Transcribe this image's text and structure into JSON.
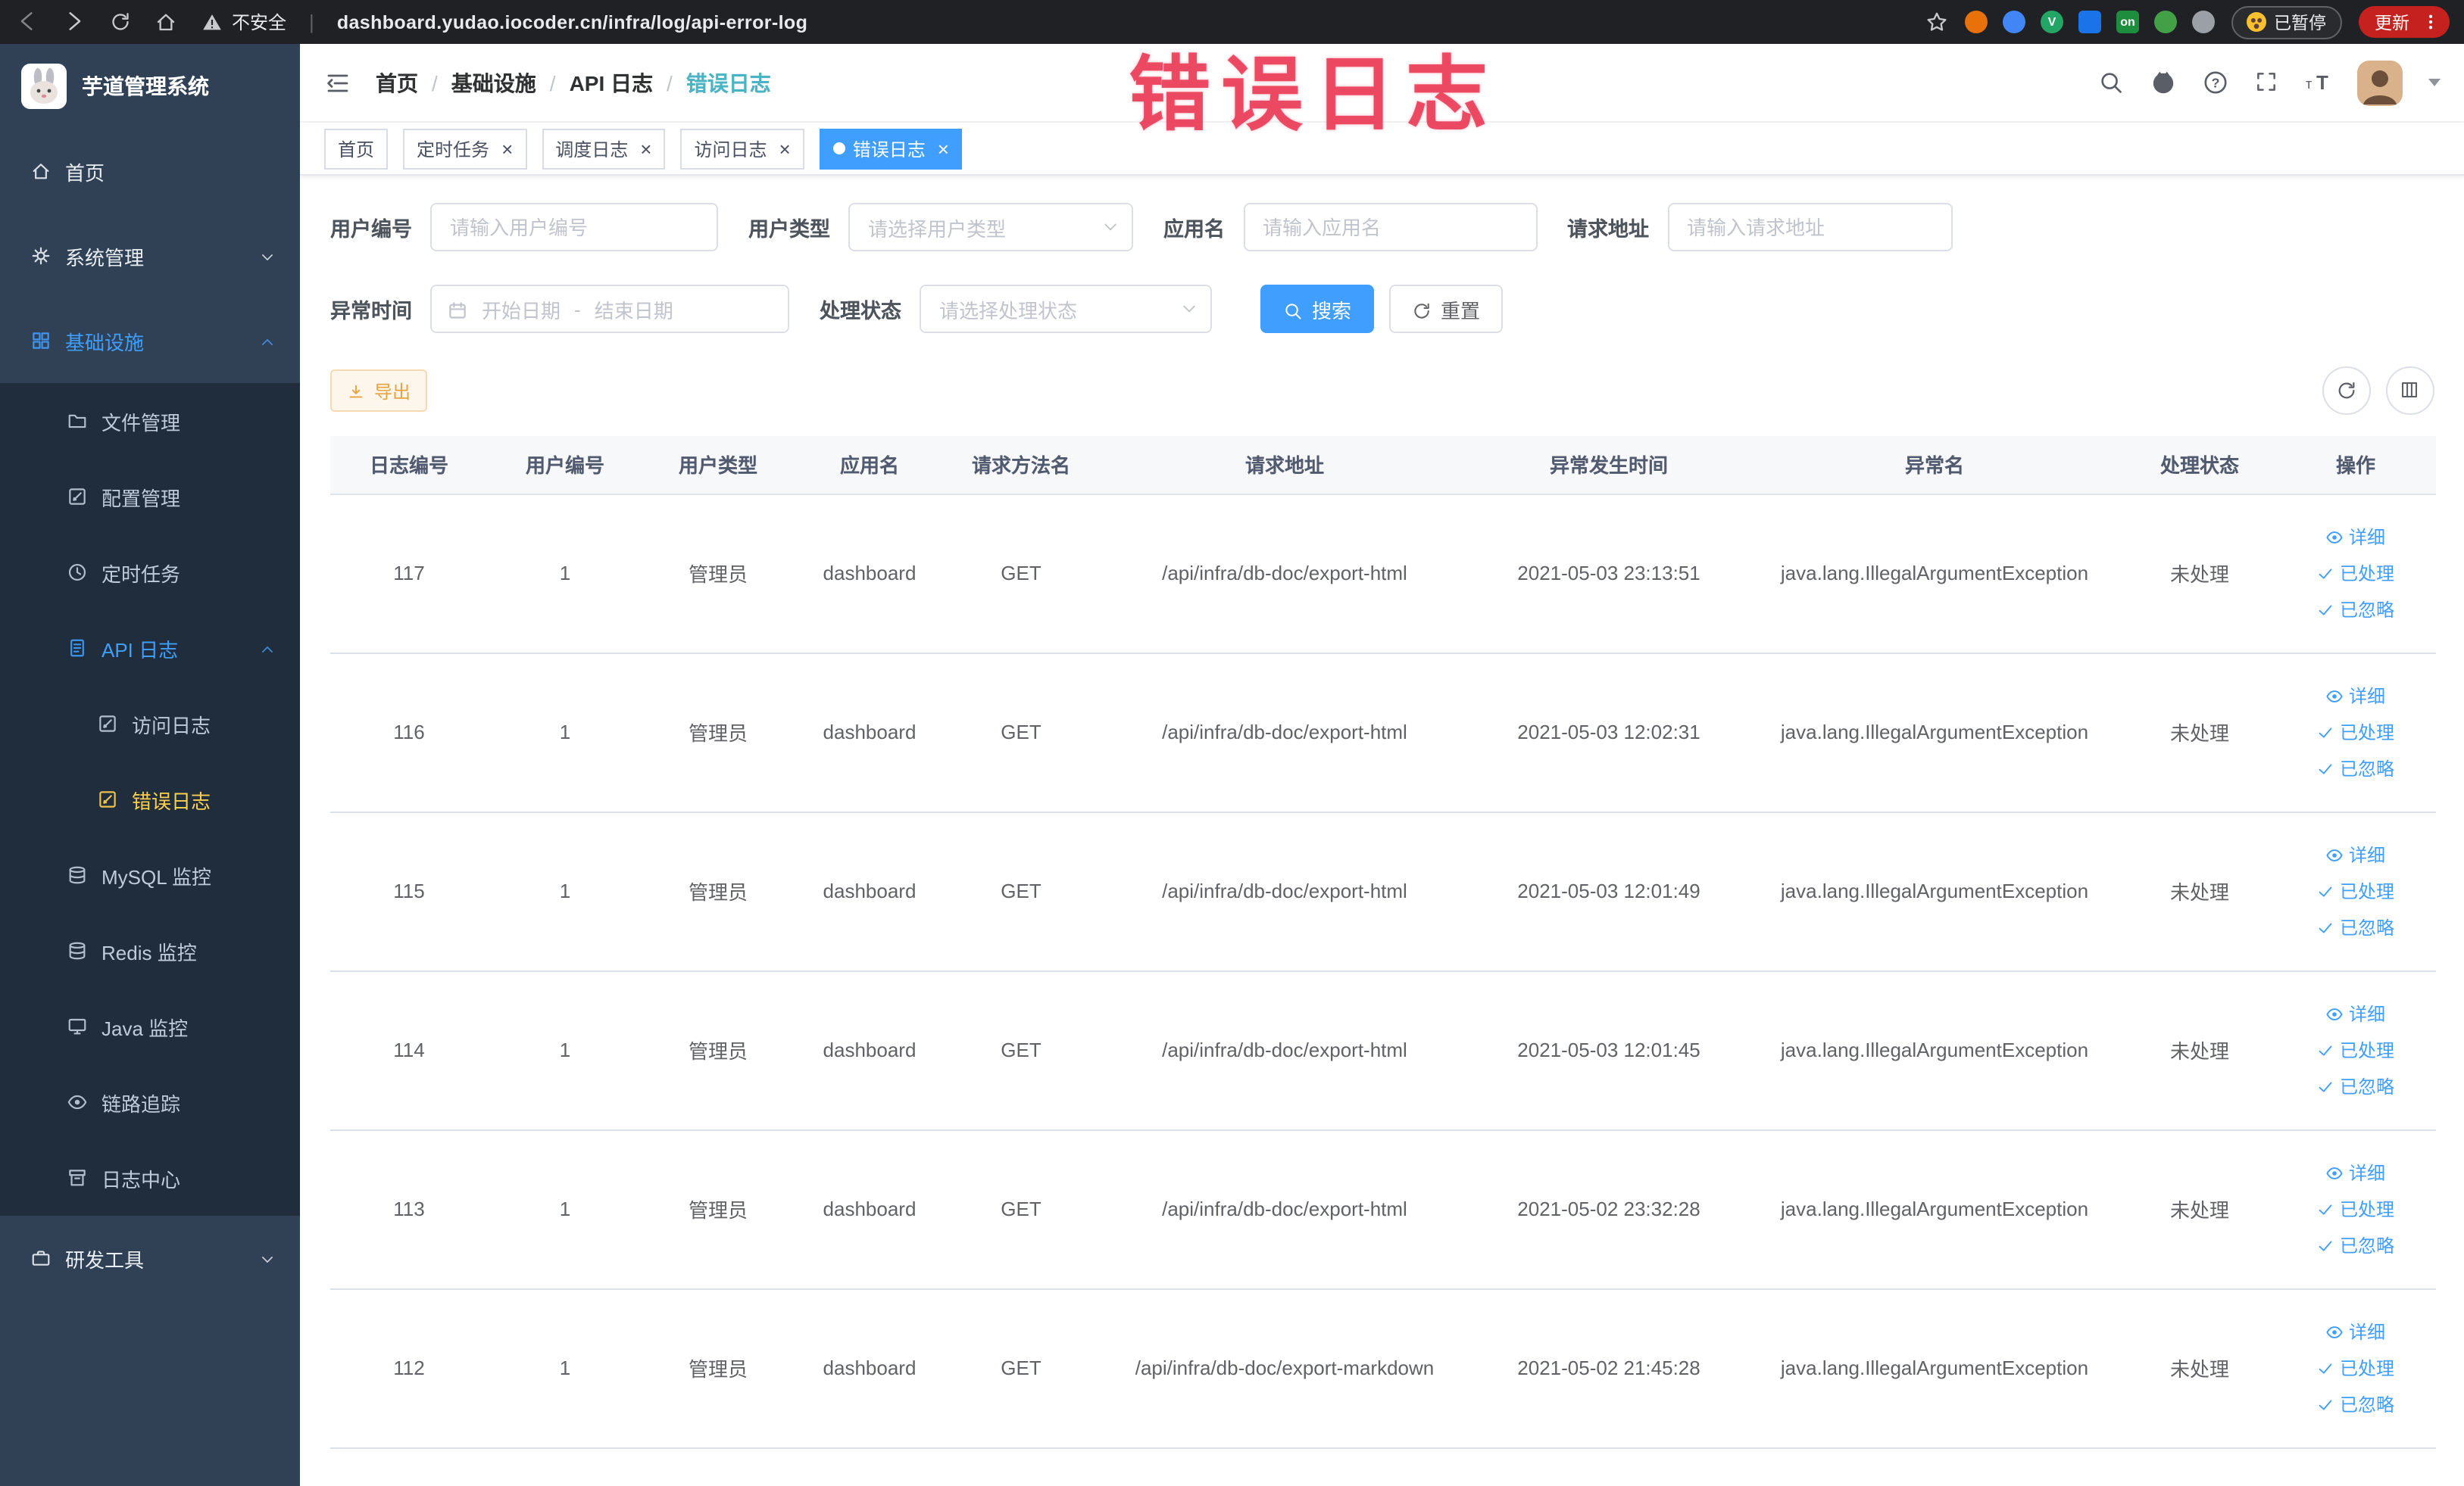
{
  "annotation": {
    "label": "错误日志"
  },
  "browser": {
    "security_text": "不安全",
    "url": "dashboard.yudao.iocoder.cn/infra/log/api-error-log",
    "paused_badge": "已暂停",
    "update_button": "更新",
    "extension_icons": [
      {
        "key": "ext-circle-red",
        "color": "#e8710a"
      },
      {
        "key": "ext-circle-blue",
        "color": "#4285f4"
      },
      {
        "key": "ext-circle-green",
        "color": "#23a566",
        "text": "V"
      },
      {
        "key": "ext-square-blue",
        "color": "#1a73e8",
        "shape": "square"
      },
      {
        "key": "ext-on-badge",
        "color": "#1e8e3e",
        "shape": "square",
        "text": "on"
      },
      {
        "key": "ext-leaf-green",
        "color": "#43a047"
      },
      {
        "key": "ext-paw-dark",
        "color": "#9aa0a6"
      }
    ]
  },
  "sidebar": {
    "logo_title": "芋道管理系统",
    "menu": [
      {
        "key": "home",
        "label": "首页",
        "icon": "home",
        "level": 0
      },
      {
        "key": "system",
        "label": "系统管理",
        "icon": "gear",
        "level": 0,
        "chevron": "down"
      },
      {
        "key": "infra",
        "label": "基础设施",
        "icon": "grid",
        "level": 0,
        "chevron": "up",
        "color": "blue"
      },
      {
        "key": "file",
        "label": "文件管理",
        "icon": "folder",
        "level": 1
      },
      {
        "key": "config",
        "label": "配置管理",
        "icon": "edit",
        "level": 1
      },
      {
        "key": "job",
        "label": "定时任务",
        "icon": "clock",
        "level": 1
      },
      {
        "key": "api-log",
        "label": "API 日志",
        "icon": "doc",
        "level": 1,
        "chevron": "up",
        "color": "blue"
      },
      {
        "key": "access-log",
        "label": "访问日志",
        "icon": "edit",
        "level": 2
      },
      {
        "key": "error-log",
        "label": "错误日志",
        "icon": "edit",
        "level": 2,
        "color": "gold"
      },
      {
        "key": "mysql",
        "label": "MySQL 监控",
        "icon": "db",
        "level": 1
      },
      {
        "key": "redis",
        "label": "Redis 监控",
        "icon": "db",
        "level": 1
      },
      {
        "key": "java",
        "label": "Java 监控",
        "icon": "monitor",
        "level": 1
      },
      {
        "key": "trace",
        "label": "链路追踪",
        "icon": "eye",
        "level": 1
      },
      {
        "key": "log-center",
        "label": "日志中心",
        "icon": "archive",
        "level": 1
      },
      {
        "key": "dev-tools",
        "label": "研发工具",
        "icon": "tool",
        "level": 0,
        "chevron": "down"
      }
    ]
  },
  "header": {
    "breadcrumb": [
      "首页",
      "基础设施",
      "API 日志",
      "错误日志"
    ]
  },
  "tags": [
    {
      "key": "home",
      "label": "首页",
      "closable": false,
      "active": false
    },
    {
      "key": "job",
      "label": "定时任务",
      "closable": true,
      "active": false
    },
    {
      "key": "job-log",
      "label": "调度日志",
      "closable": true,
      "active": false
    },
    {
      "key": "access-log",
      "label": "访问日志",
      "closable": true,
      "active": false
    },
    {
      "key": "error-log",
      "label": "错误日志",
      "closable": true,
      "active": true
    }
  ],
  "filters": {
    "user_id": {
      "label": "用户编号",
      "placeholder": "请输入用户编号"
    },
    "user_type": {
      "label": "用户类型",
      "placeholder": "请选择用户类型"
    },
    "app_name": {
      "label": "应用名",
      "placeholder": "请输入应用名"
    },
    "request_url": {
      "label": "请求地址",
      "placeholder": "请输入请求地址"
    },
    "exception_time": {
      "label": "异常时间",
      "start_placeholder": "开始日期",
      "separator": "-",
      "end_placeholder": "结束日期"
    },
    "process_status": {
      "label": "处理状态",
      "placeholder": "请选择处理状态"
    },
    "search_button": "搜索",
    "reset_button": "重置"
  },
  "toolbar": {
    "export_button": "导出"
  },
  "table": {
    "headers": [
      "日志编号",
      "用户编号",
      "用户类型",
      "应用名",
      "请求方法名",
      "请求地址",
      "异常发生时间",
      "异常名",
      "处理状态",
      "操作"
    ],
    "row_actions": [
      {
        "key": "detail",
        "label": "详细",
        "icon": "eye"
      },
      {
        "key": "processed",
        "label": "已处理",
        "icon": "check"
      },
      {
        "key": "ignored",
        "label": "已忽略",
        "icon": "check"
      }
    ],
    "rows": [
      {
        "log_id": "117",
        "user_id": "1",
        "user_type": "管理员",
        "app": "dashboard",
        "method": "GET",
        "url": "/api/infra/db-doc/export-html",
        "time": "2021-05-03 23:13:51",
        "exception": "java.lang.IllegalArgumentException",
        "status": "未处理"
      },
      {
        "log_id": "116",
        "user_id": "1",
        "user_type": "管理员",
        "app": "dashboard",
        "method": "GET",
        "url": "/api/infra/db-doc/export-html",
        "time": "2021-05-03 12:02:31",
        "exception": "java.lang.IllegalArgumentException",
        "status": "未处理"
      },
      {
        "log_id": "115",
        "user_id": "1",
        "user_type": "管理员",
        "app": "dashboard",
        "method": "GET",
        "url": "/api/infra/db-doc/export-html",
        "time": "2021-05-03 12:01:49",
        "exception": "java.lang.IllegalArgumentException",
        "status": "未处理"
      },
      {
        "log_id": "114",
        "user_id": "1",
        "user_type": "管理员",
        "app": "dashboard",
        "method": "GET",
        "url": "/api/infra/db-doc/export-html",
        "time": "2021-05-03 12:01:45",
        "exception": "java.lang.IllegalArgumentException",
        "status": "未处理"
      },
      {
        "log_id": "113",
        "user_id": "1",
        "user_type": "管理员",
        "app": "dashboard",
        "method": "GET",
        "url": "/api/infra/db-doc/export-html",
        "time": "2021-05-02 23:32:28",
        "exception": "java.lang.IllegalArgumentException",
        "status": "未处理"
      },
      {
        "log_id": "112",
        "user_id": "1",
        "user_type": "管理员",
        "app": "dashboard",
        "method": "GET",
        "url": "/api/infra/db-doc/export-markdown",
        "time": "2021-05-02 21:45:28",
        "exception": "java.lang.IllegalArgumentException",
        "status": "未处理"
      }
    ]
  },
  "colors": {
    "accent": "#409eff",
    "sidebar_bg": "#304156",
    "submenu_bg": "#1f2d3d",
    "active_menu_text": "#ffd04b",
    "tab_active_bg": "#409eff",
    "annotation_red": "#e93854",
    "export_text": "#e6a23c",
    "export_bg": "#fdf6ec",
    "export_border": "#f5dab1",
    "chrome_bg": "#202124",
    "update_button_bg": "#c5221f"
  }
}
